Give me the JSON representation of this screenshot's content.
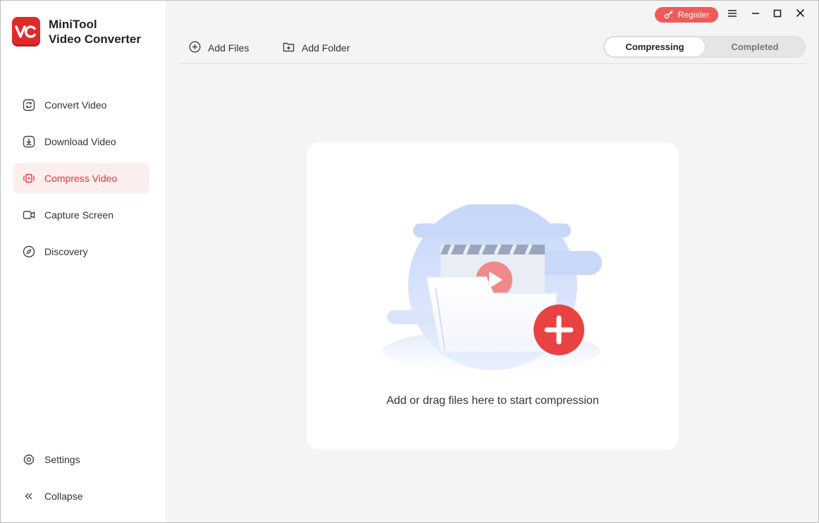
{
  "app": {
    "name_line1": "MiniTool",
    "name_line2": "Video Converter",
    "logo_icon": "vc-logo-icon"
  },
  "sidebar": {
    "items": [
      {
        "label": "Convert Video",
        "icon": "convert-icon",
        "active": false
      },
      {
        "label": "Download Video",
        "icon": "download-icon",
        "active": false
      },
      {
        "label": "Compress Video",
        "icon": "compress-icon",
        "active": true
      },
      {
        "label": "Capture Screen",
        "icon": "camera-icon",
        "active": false
      },
      {
        "label": "Discovery",
        "icon": "compass-icon",
        "active": false
      }
    ],
    "bottom": [
      {
        "label": "Settings",
        "icon": "gear-icon"
      },
      {
        "label": "Collapse",
        "icon": "double-chevron-left-icon"
      }
    ]
  },
  "titlebar": {
    "register_label": "Register",
    "icons": [
      "key-icon",
      "menu-icon",
      "minimize-icon",
      "maximize-icon",
      "close-icon"
    ]
  },
  "toolbar": {
    "add_files_label": "Add Files",
    "add_folder_label": "Add Folder"
  },
  "tabs": {
    "items": [
      "Compressing",
      "Completed"
    ],
    "selected": "Compressing"
  },
  "dropzone": {
    "message": "Add or drag files here to start compression"
  },
  "colors": {
    "accent": "#e02a2a",
    "active_bg": "#fdeeee",
    "register_bg": "#ef5a5a",
    "content_bg": "#f4f4f4"
  }
}
